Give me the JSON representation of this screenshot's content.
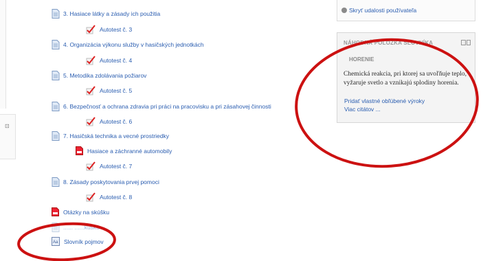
{
  "course": {
    "items": [
      {
        "type": "doc",
        "label": "3. Hasiace látky a zásady ich použitia"
      },
      {
        "type": "quiz",
        "label": "Autotest č. 3"
      },
      {
        "type": "doc",
        "label": "4. Organizácia výkonu služby v hasičských jednotkách"
      },
      {
        "type": "quiz",
        "label": "Autotest č. 4"
      },
      {
        "type": "doc",
        "label": "5. Metodika zdolávania požiarov"
      },
      {
        "type": "quiz",
        "label": "Autotest č. 5"
      },
      {
        "type": "doc",
        "label": "6. Bezpečnosť a ochrana zdravia pri práci na pracovisku a pri zásahovej činnosti"
      },
      {
        "type": "quiz",
        "label": "Autotest č. 6"
      },
      {
        "type": "doc",
        "label": "7. Hasičská technika a vecné prostriedky"
      },
      {
        "type": "pdf",
        "label": "Hasiace a záchranné automobily"
      },
      {
        "type": "quiz",
        "label": "Autotest č. 7"
      },
      {
        "type": "doc",
        "label": "8. Zásady poskytovania prvej pomoci"
      },
      {
        "type": "quiz",
        "label": "Autotest č. 8"
      },
      {
        "type": "pdf",
        "label": "Otázky na skúšku"
      },
      {
        "type": "doc",
        "label": "...... ......kúšku"
      },
      {
        "type": "glossary",
        "label": "Slovník pojmov"
      }
    ]
  },
  "events_block": {
    "hide_user_events": "Skryť udalosti používateľa"
  },
  "glossary_block": {
    "title": "NÁHODNÁ POLOŽKA SLOVNÍKA",
    "term": "HORENIE",
    "definition": "Chemická reakcia, pri ktorej sa uvoľňuje teplo, vyžaruje svetlo a vznikajú splodiny horenia.",
    "add_quotes": "Pridať vlastné obľúbené výroky",
    "more_quotes": "Viac citátov ..."
  },
  "icons": {
    "document": "document-icon",
    "quiz": "checkmark-quiz-icon",
    "pdf": "pdf-icon",
    "glossary": "glossary-icon",
    "eye": "eye-icon"
  },
  "colors": {
    "link": "#2a5db0",
    "annotation": "#cc1111",
    "block_bg": "#f4f4f4"
  }
}
